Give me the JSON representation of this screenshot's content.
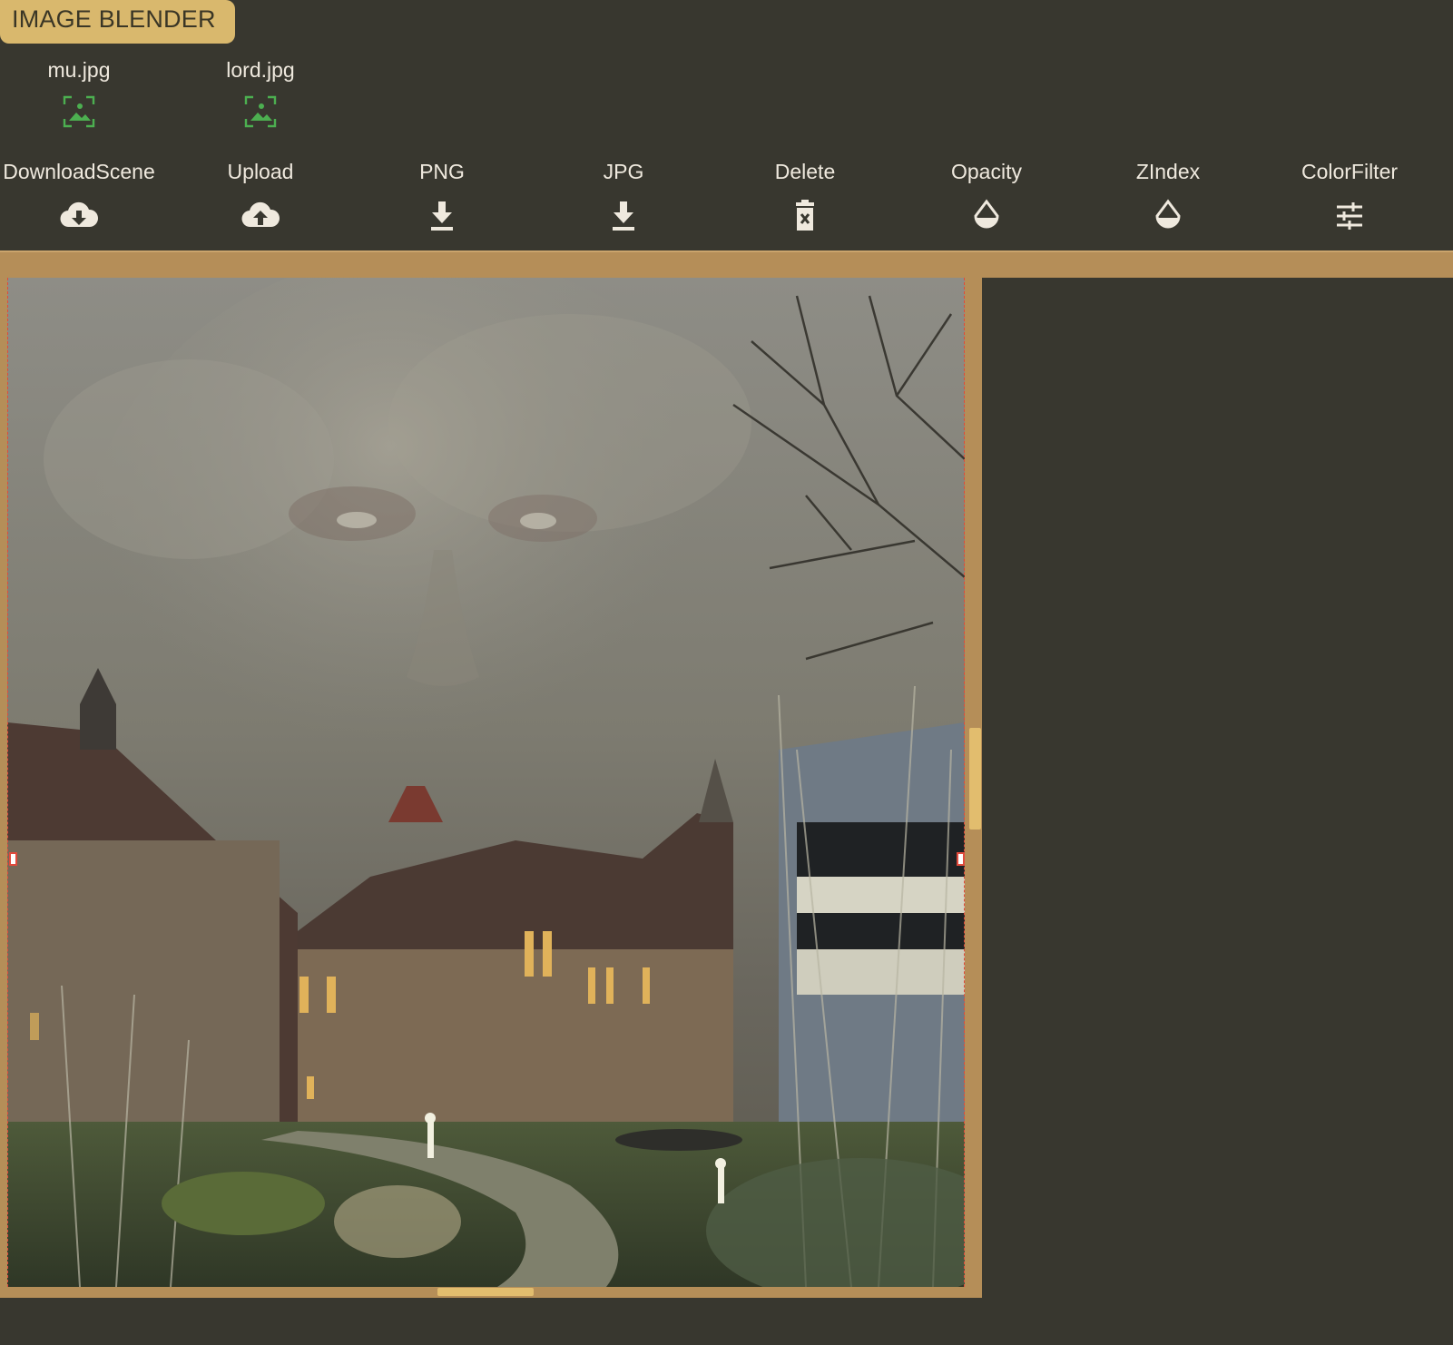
{
  "app": {
    "title": "IMAGE BLENDER"
  },
  "files": [
    {
      "name": "mu.jpg",
      "icon": "image-placeholder-icon"
    },
    {
      "name": "lord.jpg",
      "icon": "image-placeholder-icon"
    }
  ],
  "toolbar": [
    {
      "label": "DownloadScene",
      "icon": "cloud-download-icon"
    },
    {
      "label": "Upload",
      "icon": "cloud-upload-icon"
    },
    {
      "label": "PNG",
      "icon": "download-icon"
    },
    {
      "label": "JPG",
      "icon": "download-icon"
    },
    {
      "label": "Delete",
      "icon": "trash-icon"
    },
    {
      "label": "Opacity",
      "icon": "droplet-icon"
    },
    {
      "label": "ZIndex",
      "icon": "droplet-icon"
    },
    {
      "label": "ColorFilter",
      "icon": "sliders-icon"
    }
  ],
  "colors": {
    "background": "#38372f",
    "accent": "#d9b86d",
    "frame": "#b58e58",
    "thumb_icon": "#4caf50",
    "selection": "#e04a3c"
  }
}
